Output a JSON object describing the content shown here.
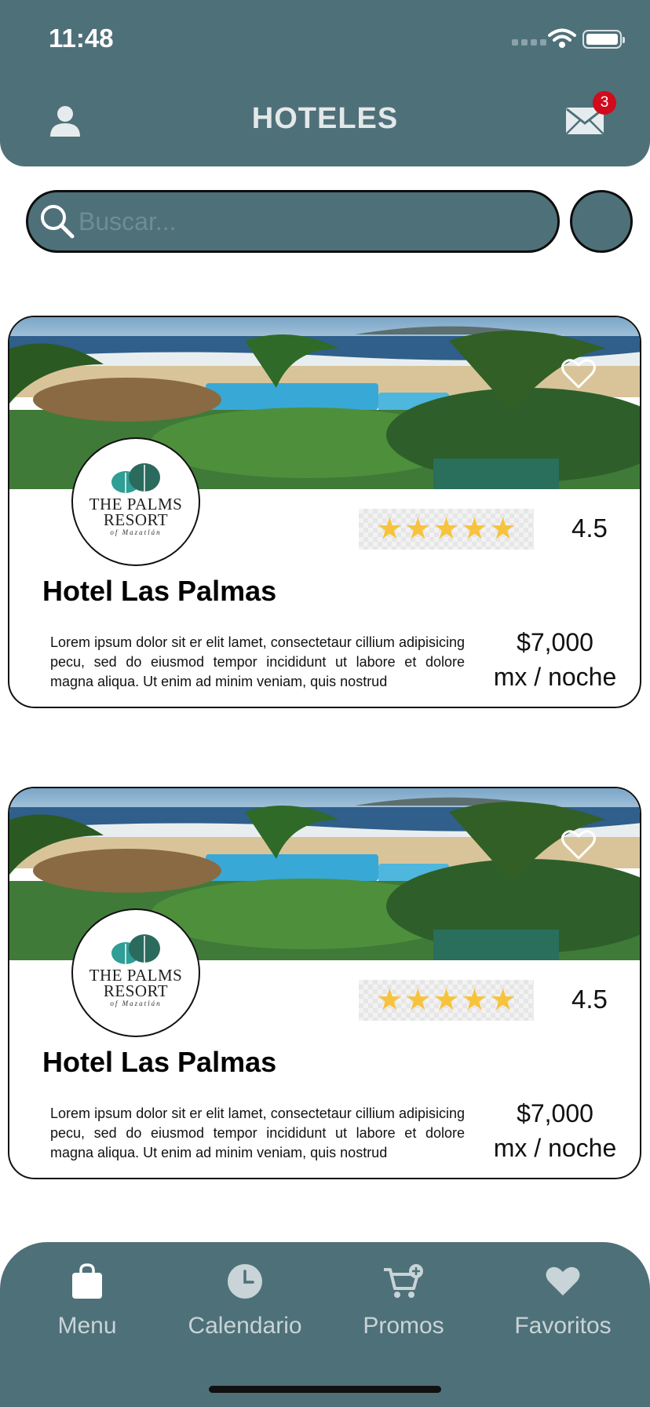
{
  "status_bar": {
    "time": "11:48"
  },
  "header": {
    "title": "HOTELES",
    "mail_badge": "3",
    "user_icon": "user-icon",
    "mail_icon": "mail-icon"
  },
  "search": {
    "placeholder": "Buscar...",
    "value": ""
  },
  "hotels": [
    {
      "logo_line1": "THE PALMS",
      "logo_line2": "RESORT",
      "logo_line3": "of Mazatlán",
      "rating": "4.5",
      "stars": 5,
      "name": "Hotel Las Palmas",
      "description": "Lorem ipsum dolor sit er elit lamet, consectetaur cillium adipisicing pecu, sed do eiusmod tempor incididunt ut labore et dolore magna aliqua. Ut enim ad minim veniam, quis nostrud",
      "price": "$7,000",
      "price_unit": "mx / noche"
    },
    {
      "logo_line1": "THE PALMS",
      "logo_line2": "RESORT",
      "logo_line3": "of Mazatlán",
      "rating": "4.5",
      "stars": 5,
      "name": "Hotel Las Palmas",
      "description": "Lorem ipsum dolor sit er elit lamet, consectetaur cillium adipisicing pecu, sed do eiusmod tempor incididunt ut labore et dolore magna aliqua. Ut enim ad minim veniam, quis nostrud",
      "price": "$7,000",
      "price_unit": "mx / noche"
    }
  ],
  "nav": [
    {
      "label": "Menu",
      "icon": "bag-icon"
    },
    {
      "label": "Calendario",
      "icon": "clock-icon"
    },
    {
      "label": "Promos",
      "icon": "cart-add-icon"
    },
    {
      "label": "Favoritos",
      "icon": "heart-icon"
    }
  ],
  "colors": {
    "primary": "#4e7079",
    "badge": "#d10a1c",
    "star": "#f7c33c"
  }
}
